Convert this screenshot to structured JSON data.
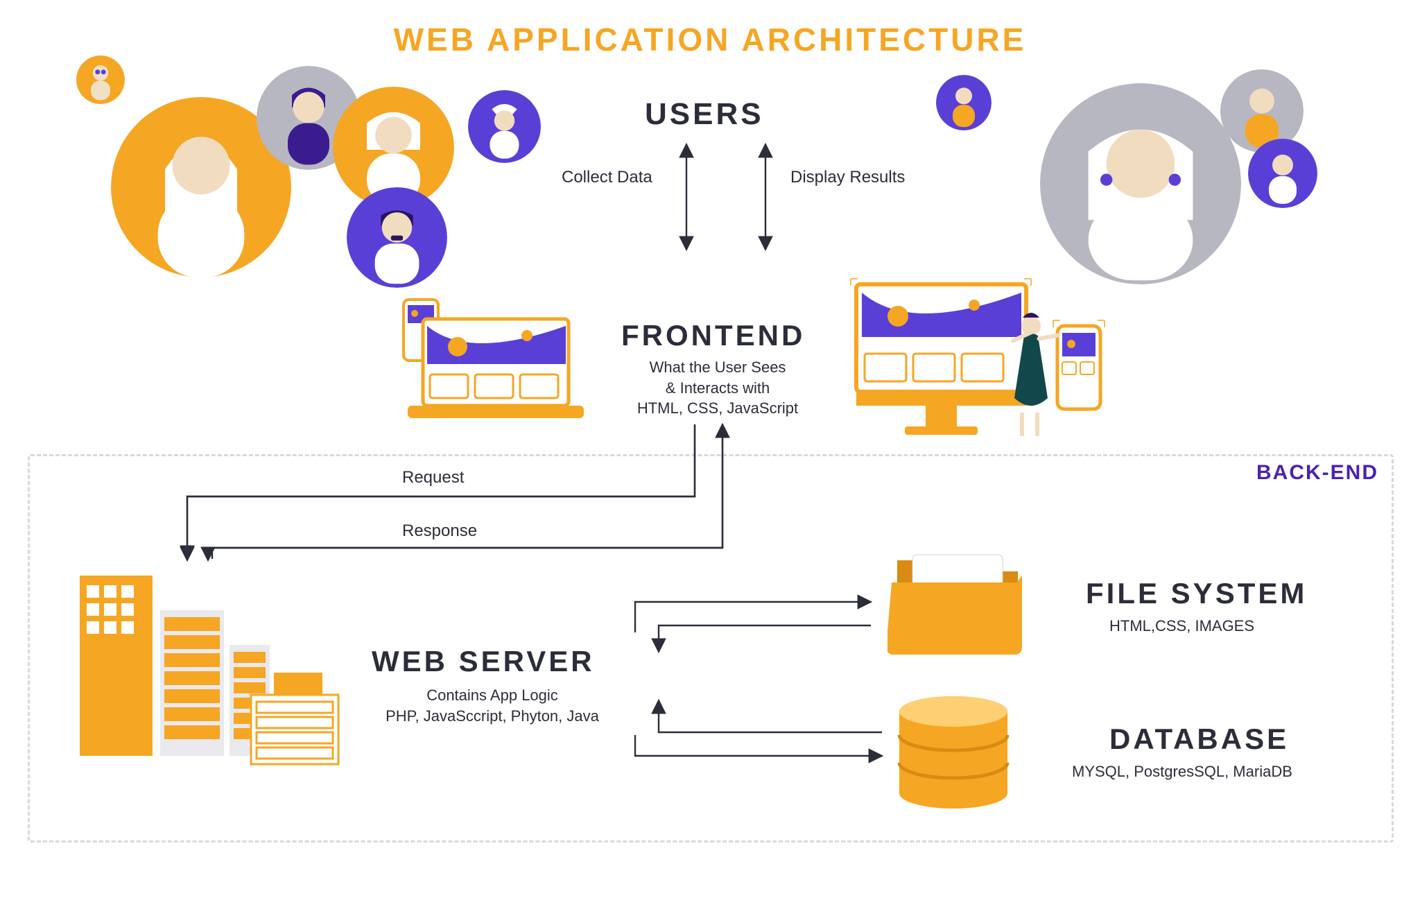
{
  "title": "WEB APPLICATION ARCHITECTURE",
  "nodes": {
    "users": {
      "heading": "USERS"
    },
    "frontend": {
      "heading": "FRONTEND",
      "sub1": "What the User Sees",
      "sub2": "& Interacts with",
      "sub3": "HTML, CSS, JavaScript"
    },
    "webserver": {
      "heading": "WEB SERVER",
      "sub1": "Contains App Logic",
      "sub2": "PHP, JavaSccript, Phyton, Java"
    },
    "filesystem": {
      "heading": "FILE SYSTEM",
      "sub": "HTML,CSS, IMAGES"
    },
    "database": {
      "heading": "DATABASE",
      "sub": "MYSQL, PostgresSQL, MariaDB"
    }
  },
  "labels": {
    "collect": "Collect Data",
    "display": "Display Results",
    "request": "Request",
    "response": "Response",
    "backend": "BACK-END"
  },
  "colors": {
    "accent_yellow": "#F5A623",
    "accent_purple": "#5A3FD6",
    "text_dark": "#2b2d3a",
    "ui_grey": "#b7b7c2"
  }
}
